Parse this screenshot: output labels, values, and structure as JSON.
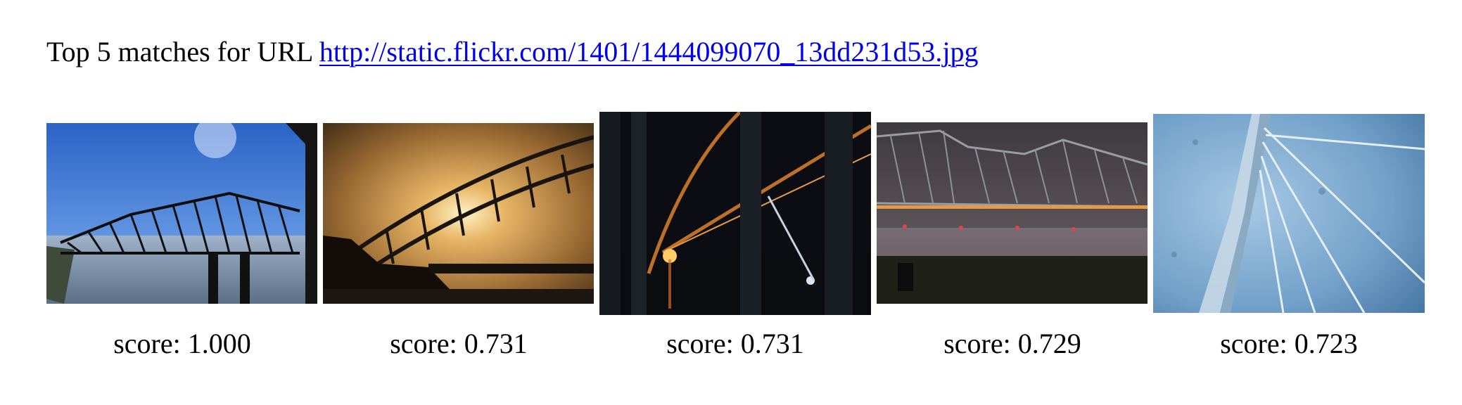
{
  "header": {
    "prefix": "Top 5 matches for URL",
    "url": "http://static.flickr.com/1401/1444099070_13dd231d53.jpg"
  },
  "results": [
    {
      "score_label": "score: 1.000",
      "image": "steel-truss-bridge-blue-sky"
    },
    {
      "score_label": "score: 0.731",
      "image": "arch-bridge-sunset"
    },
    {
      "score_label": "score: 0.731",
      "image": "bridge-underside-night-lights"
    },
    {
      "score_label": "score: 0.729",
      "image": "truss-bridge-night-mist"
    },
    {
      "score_label": "score: 0.723",
      "image": "cable-stayed-bridge-blue"
    }
  ]
}
